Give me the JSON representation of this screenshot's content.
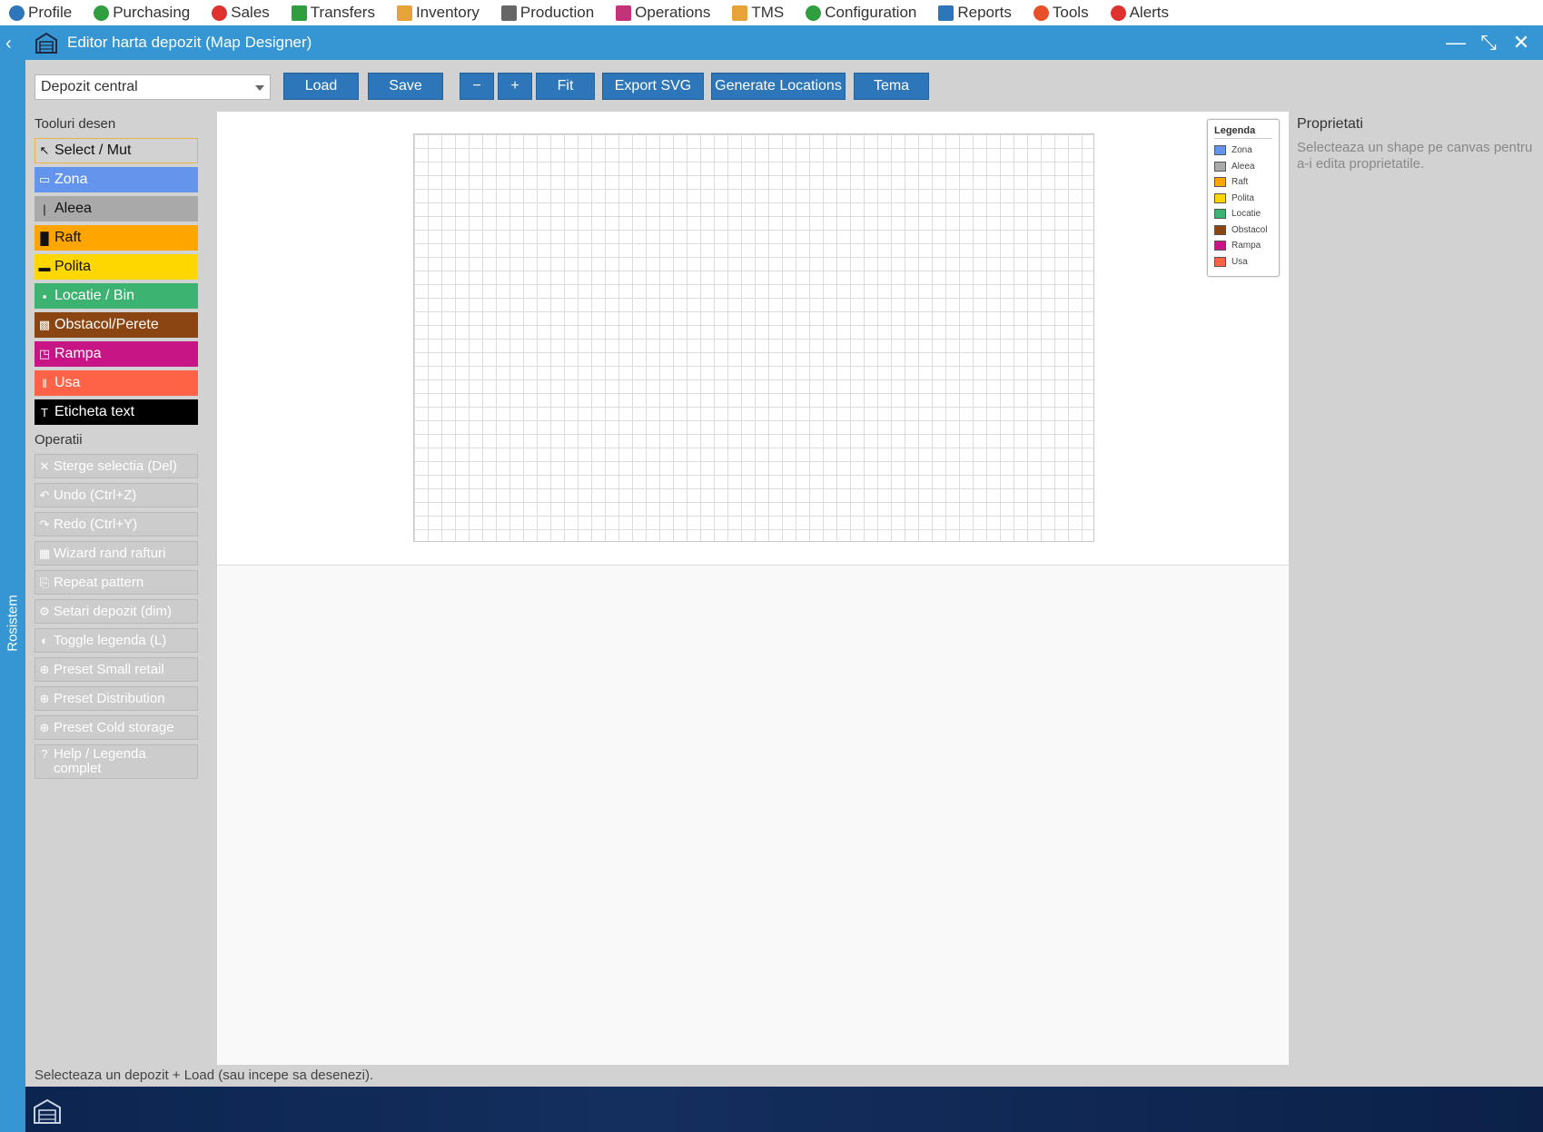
{
  "menu": [
    {
      "label": "Profile",
      "icon": "user-icon",
      "color": "#2d76b9"
    },
    {
      "label": "Purchasing",
      "icon": "plus-circle-icon",
      "color": "#2e9e3e"
    },
    {
      "label": "Sales",
      "icon": "minus-circle-icon",
      "color": "#e03131"
    },
    {
      "label": "Transfers",
      "icon": "transfers-icon",
      "color": "#2e9e3e"
    },
    {
      "label": "Inventory",
      "icon": "inventory-icon",
      "color": "#e8a23a"
    },
    {
      "label": "Production",
      "icon": "production-icon",
      "color": "#666666"
    },
    {
      "label": "Operations",
      "icon": "operations-icon",
      "color": "#c2337a"
    },
    {
      "label": "TMS",
      "icon": "truck-icon",
      "color": "#e8a23a"
    },
    {
      "label": "Configuration",
      "icon": "configuration-icon",
      "color": "#2e9e3e"
    },
    {
      "label": "Reports",
      "icon": "reports-icon",
      "color": "#2d76b9"
    },
    {
      "label": "Tools",
      "icon": "gear-icon",
      "color": "#e8502a"
    },
    {
      "label": "Alerts",
      "icon": "bell-icon",
      "color": "#e03131"
    }
  ],
  "window": {
    "title": "Editor harta depozit (Map Designer)",
    "controls": {
      "minimize": "—",
      "restore": "⤡",
      "close": "✕"
    }
  },
  "side_strip": {
    "label": "Rosistem",
    "back": "‹"
  },
  "toolbar": {
    "depot_value": "Depozit central",
    "buttons": [
      {
        "id": "load",
        "label": "Load"
      },
      {
        "id": "save",
        "label": "Save"
      },
      {
        "id": "zoom-out",
        "label": "−"
      },
      {
        "id": "zoom-in",
        "label": "+"
      },
      {
        "id": "fit",
        "label": "Fit"
      },
      {
        "id": "export-svg",
        "label": "Export SVG"
      },
      {
        "id": "generate-locations",
        "label": "Generate Locations"
      },
      {
        "id": "tema",
        "label": "Tema"
      }
    ]
  },
  "tools": {
    "heading": "Tooluri desen",
    "items": [
      {
        "label": "Select / Mut",
        "glyph": "↖",
        "bg": "#d2d2d2",
        "fg": "#111111",
        "border": "#e8b44a"
      },
      {
        "label": "Zona",
        "glyph": "▭",
        "bg": "#6495ed",
        "fg": "#ffffff"
      },
      {
        "label": "Aleea",
        "glyph": "|",
        "bg": "#a9a9a9",
        "fg": "#111111"
      },
      {
        "label": "Raft",
        "glyph": "█",
        "bg": "#ffa500",
        "fg": "#111111"
      },
      {
        "label": "Polita",
        "glyph": "▬",
        "bg": "#ffd700",
        "fg": "#111111"
      },
      {
        "label": "Locatie / Bin",
        "glyph": "▪",
        "bg": "#3cb371",
        "fg": "#ffffff"
      },
      {
        "label": "Obstacol/Perete",
        "glyph": "▩",
        "bg": "#8b4513",
        "fg": "#ffffff"
      },
      {
        "label": "Rampa",
        "glyph": "◳",
        "bg": "#c71585",
        "fg": "#ffffff"
      },
      {
        "label": "Usa",
        "glyph": "‖",
        "bg": "#ff6347",
        "fg": "#ffffff"
      },
      {
        "label": "Eticheta text",
        "glyph": "T",
        "bg": "#000000",
        "fg": "#ffffff"
      }
    ]
  },
  "operations": {
    "heading": "Operatii",
    "items": [
      {
        "label": "Sterge selectia (Del)",
        "glyph": "✕"
      },
      {
        "label": "Undo (Ctrl+Z)",
        "glyph": "↶"
      },
      {
        "label": "Redo (Ctrl+Y)",
        "glyph": "↷"
      },
      {
        "label": "Wizard rand rafturi",
        "glyph": "▦"
      },
      {
        "label": "Repeat pattern",
        "glyph": "⎘"
      },
      {
        "label": "Setari depozit (dim)",
        "glyph": "⚙"
      },
      {
        "label": "Toggle legenda (L)",
        "glyph": "◐"
      },
      {
        "label": "Preset Small retail",
        "glyph": "⊕"
      },
      {
        "label": "Preset Distribution",
        "glyph": "⊕"
      },
      {
        "label": "Preset Cold storage",
        "glyph": "⊕"
      },
      {
        "label": "Help / Legenda complet",
        "glyph": "?"
      }
    ]
  },
  "legend": {
    "title": "Legenda",
    "items": [
      {
        "label": "Zona",
        "color": "#6495ed"
      },
      {
        "label": "Aleea",
        "color": "#a9a9a9"
      },
      {
        "label": "Raft",
        "color": "#ffa500"
      },
      {
        "label": "Polita",
        "color": "#ffd700"
      },
      {
        "label": "Locatie",
        "color": "#3cb371"
      },
      {
        "label": "Obstacol",
        "color": "#8b4513"
      },
      {
        "label": "Rampa",
        "color": "#c71585"
      },
      {
        "label": "Usa",
        "color": "#ff6347"
      }
    ]
  },
  "properties": {
    "heading": "Proprietati",
    "hint": "Selecteaza un shape pe canvas pentru a-i edita proprietatile."
  },
  "status": "Selecteaza un depozit + Load (sau incepe sa desenezi)."
}
